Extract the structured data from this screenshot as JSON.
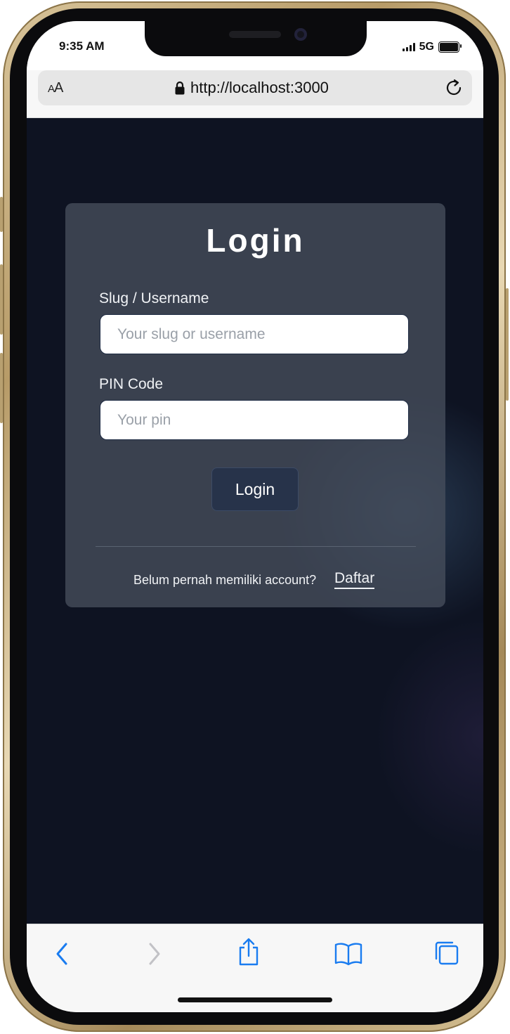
{
  "status_bar": {
    "time": "9:35 AM",
    "network": "5G"
  },
  "browser": {
    "text_size_label_small": "A",
    "text_size_label_large": "A",
    "url": "http://localhost:3000"
  },
  "login_form": {
    "title": "Login",
    "username_label": "Slug / Username",
    "username_placeholder": "Your slug or username",
    "pin_label": "PIN Code",
    "pin_placeholder": "Your pin",
    "submit_label": "Login",
    "footer_prompt": "Belum pernah memiliki account?",
    "register_link": "Daftar"
  },
  "icons": {
    "lock": "lock-icon",
    "reload": "reload-icon",
    "back": "chevron-left-icon",
    "forward": "chevron-right-icon",
    "share": "share-icon",
    "bookmarks": "book-icon",
    "tabs": "tabs-icon"
  },
  "colors": {
    "page_background": "#0e1322",
    "card_background": "#464e5c",
    "button_background": "#27334a",
    "toolbar_accent": "#1a7cf0"
  }
}
